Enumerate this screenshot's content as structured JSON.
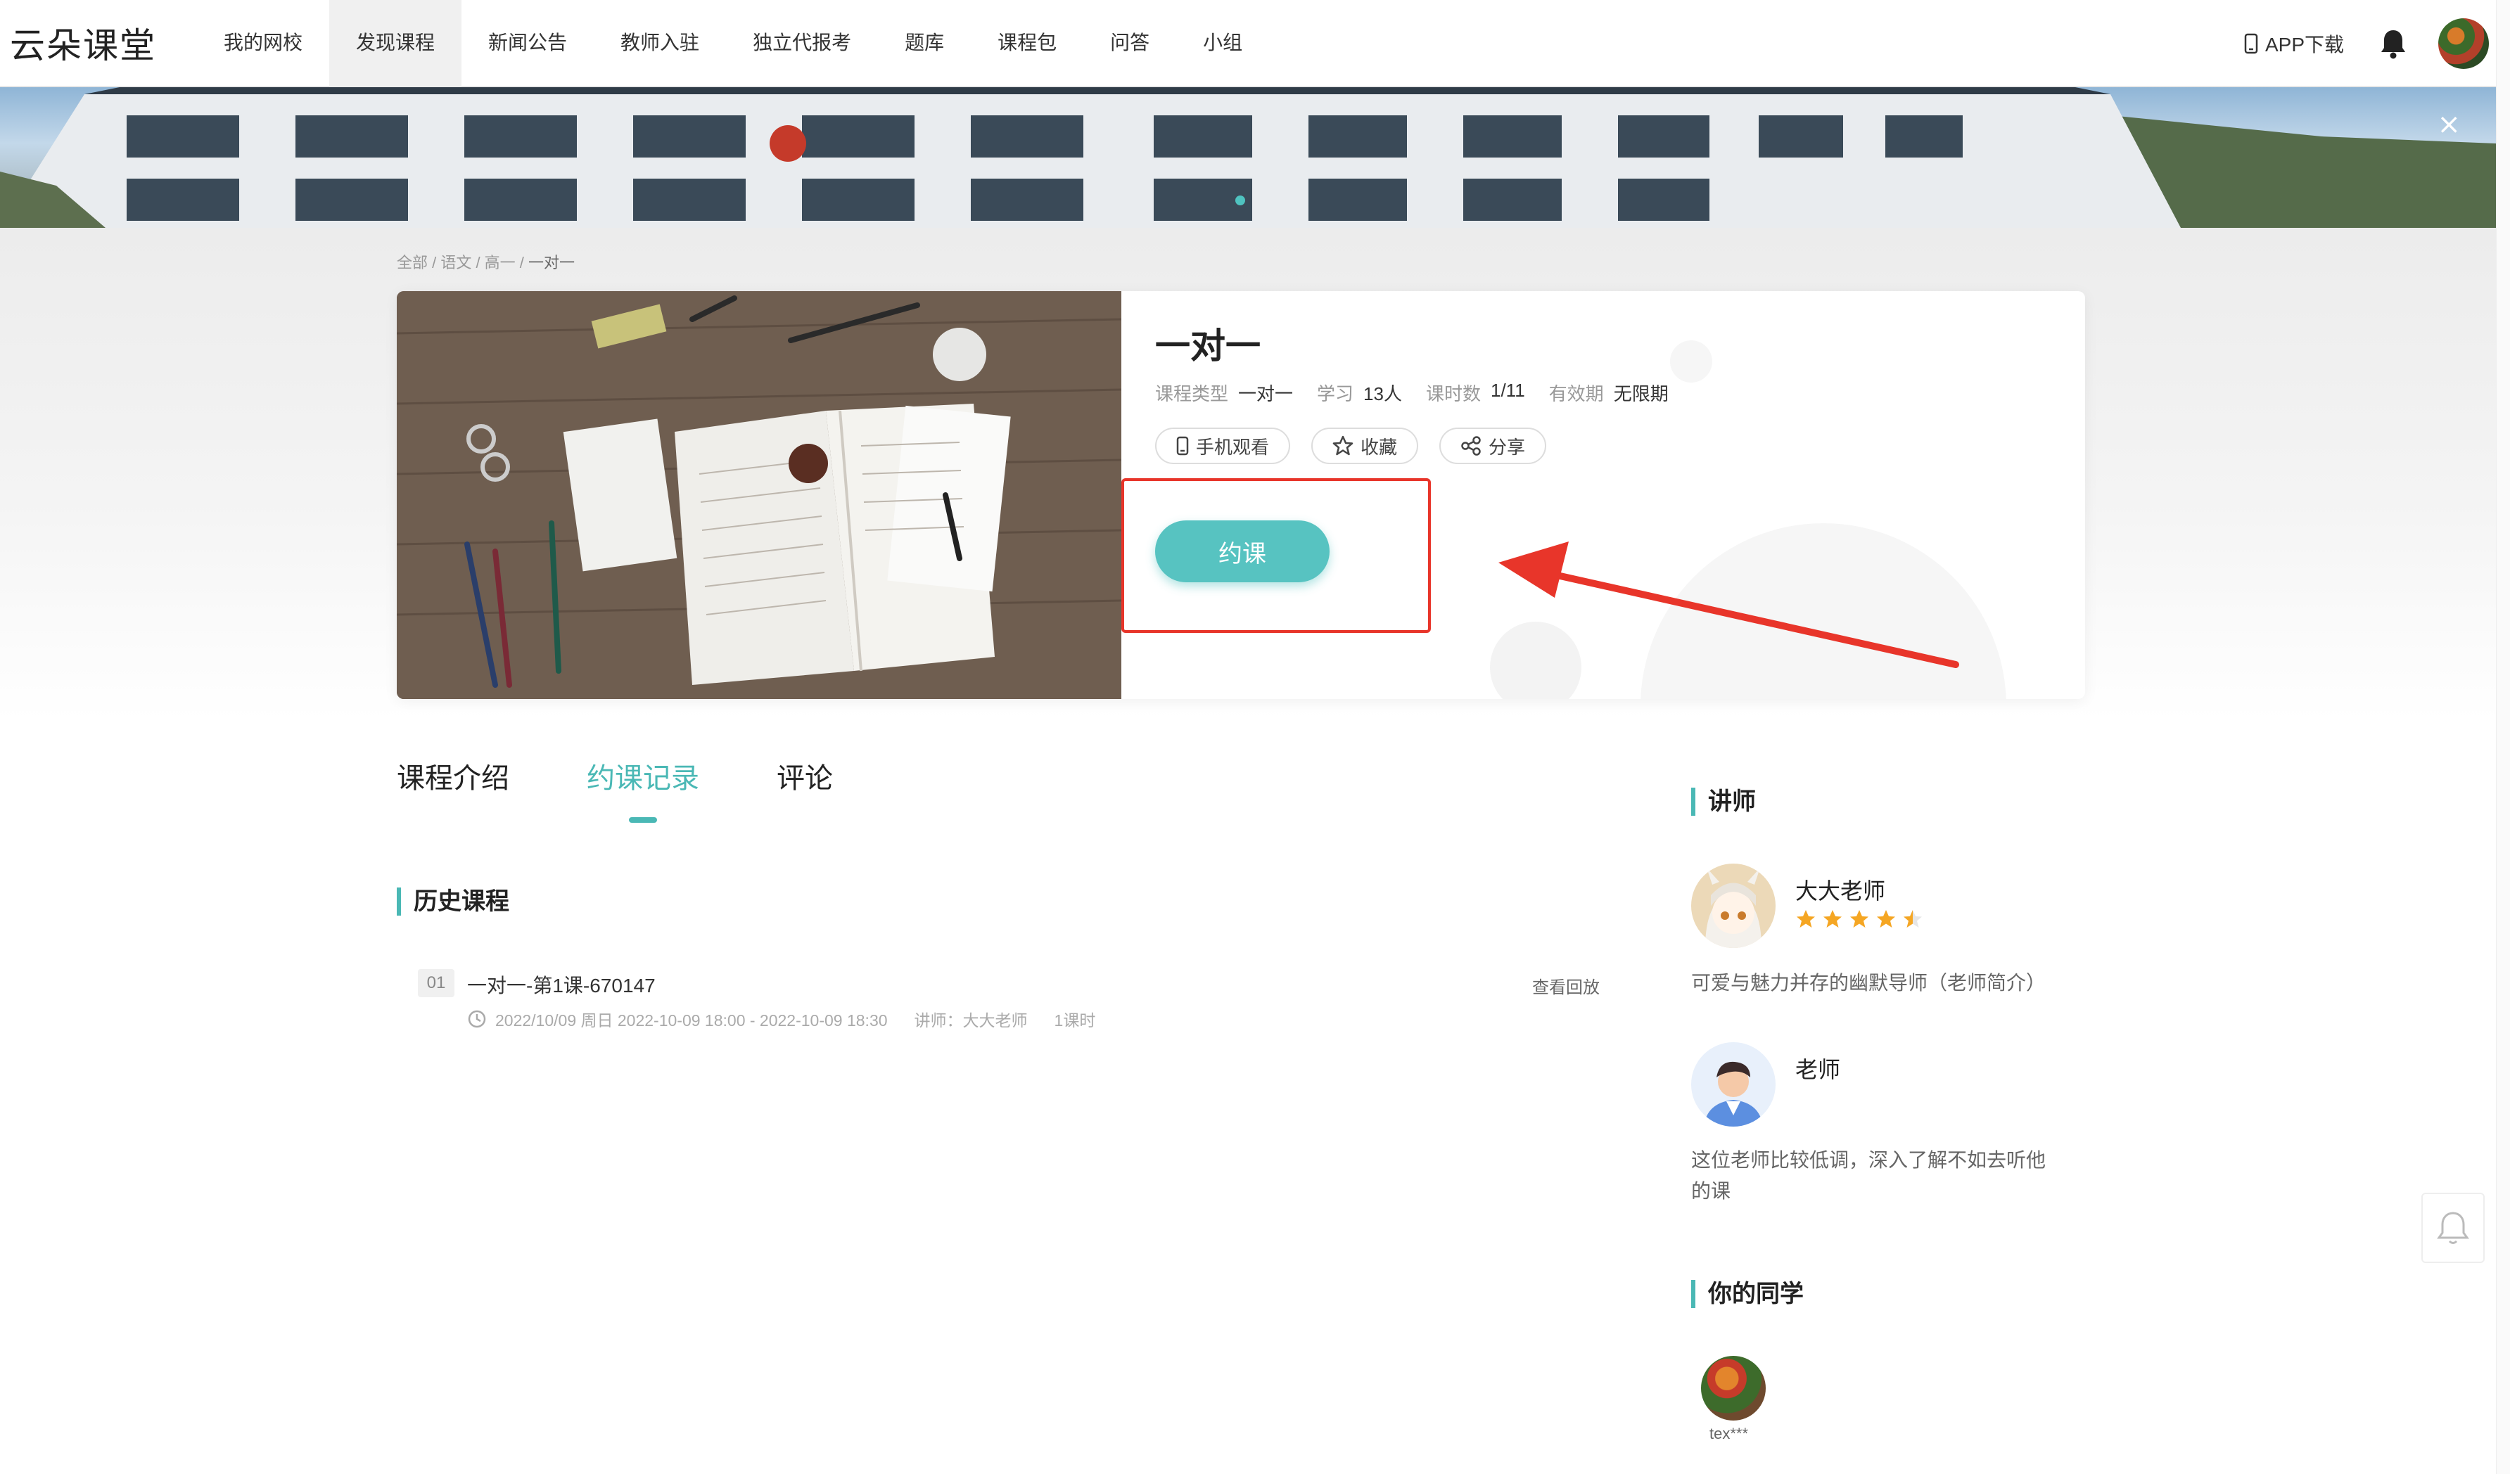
{
  "brand": "云朵课堂",
  "nav": {
    "items": [
      "我的网校",
      "发现课程",
      "新闻公告",
      "教师入驻",
      "独立代报考",
      "题库",
      "课程包",
      "问答",
      "小组"
    ],
    "active_index": 1,
    "app_download": "APP下载"
  },
  "banner": {
    "close_glyph": "×"
  },
  "breadcrumb": {
    "path": "全部 / 语文 / 高一 / ",
    "current": "一对一"
  },
  "course": {
    "title": "一对一",
    "meta": [
      {
        "label": "课程类型",
        "value": "一对一"
      },
      {
        "label": "学习",
        "value": "13人"
      },
      {
        "label": "课时数",
        "value": "1/11"
      },
      {
        "label": "有效期",
        "value": "无限期"
      }
    ],
    "actions": {
      "mobile": "手机观看",
      "favorite": "收藏",
      "share": "分享"
    },
    "book_button": "约课"
  },
  "tabs": [
    "课程介绍",
    "约课记录",
    "评论"
  ],
  "active_tab": 1,
  "history": {
    "heading": "历史课程",
    "lessons": [
      {
        "no": "01",
        "title": "一对一-第1课-670147",
        "time": "2022/10/09 周日 2022-10-09 18:00 - 2022-10-09 18:30",
        "teacher": "讲师：大大老师",
        "hours": "1课时",
        "replay": "查看回放"
      }
    ]
  },
  "sidebar": {
    "teachers_heading": "讲师",
    "teachers": [
      {
        "name": "大大老师",
        "rating": 4.5,
        "desc": "可爱与魅力并存的幽默导师（老师简介）"
      },
      {
        "name": "老师",
        "desc_line1": "这位老师比较低调，深入了解不如去听他",
        "desc_line2": "的课"
      }
    ],
    "classmates_heading": "你的同学",
    "classmates": [
      {
        "name": "tex***"
      }
    ]
  },
  "colors": {
    "accent": "#4ab8b5",
    "button": "#57c3c1",
    "annotation_red": "#e8352a",
    "star": "#f5a623"
  },
  "icons": [
    "phone-icon",
    "bell-icon",
    "star-outline-icon",
    "share-icon",
    "clock-icon",
    "close-icon",
    "chat-bell-icon"
  ]
}
